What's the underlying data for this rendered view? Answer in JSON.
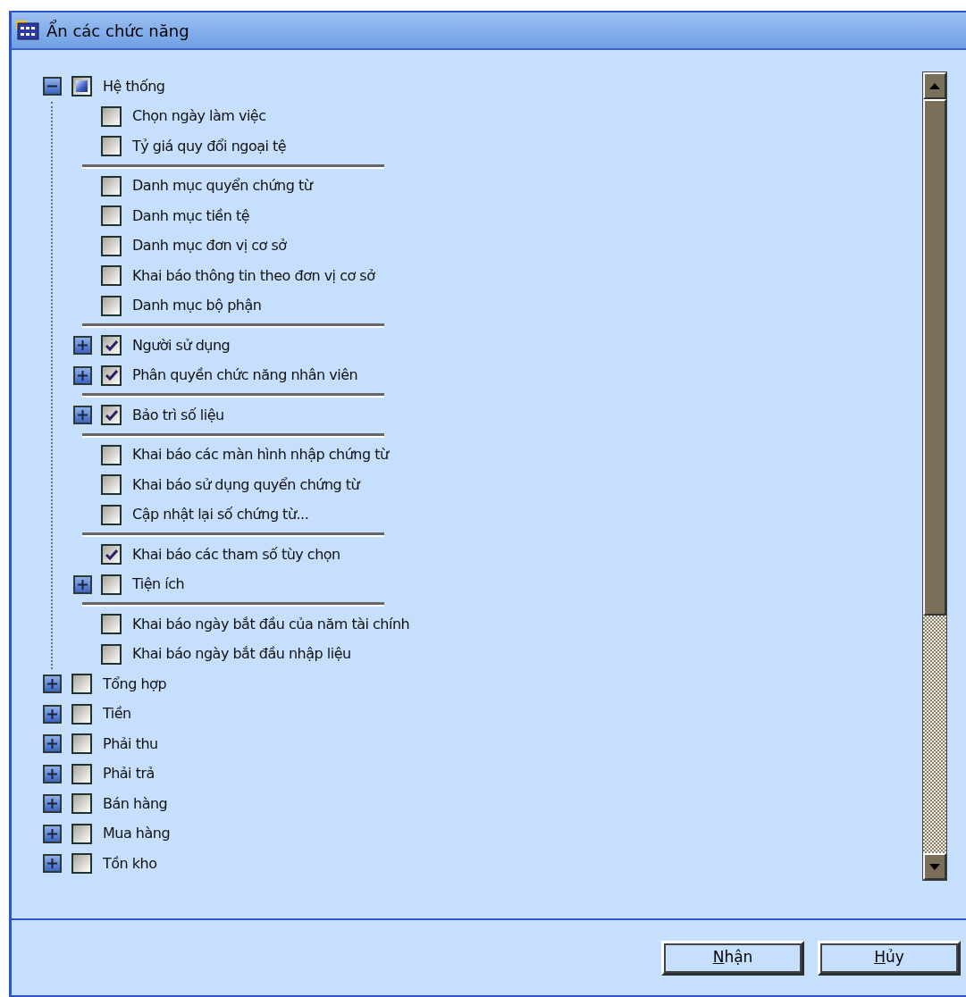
{
  "window": {
    "title": "Ẩn các chức năng"
  },
  "tree": [
    {
      "label": "Hệ thống",
      "expanded": true,
      "checked": false,
      "indeterminate": true,
      "children": [
        {
          "kind": "item",
          "label": "Chọn ngày làm việc",
          "checked": false
        },
        {
          "kind": "item",
          "label": "Tỷ giá quy đổi ngoại tệ",
          "checked": false
        },
        {
          "kind": "separator"
        },
        {
          "kind": "item",
          "label": "Danh mục quyển chứng từ",
          "checked": false
        },
        {
          "kind": "item",
          "label": "Danh mục tiền tệ",
          "checked": false
        },
        {
          "kind": "item",
          "label": "Danh mục đơn vị cơ sở",
          "checked": false
        },
        {
          "kind": "item",
          "label": "Khai báo thông tin theo đơn vị cơ sở",
          "checked": false
        },
        {
          "kind": "item",
          "label": "Danh mục bộ phận",
          "checked": false
        },
        {
          "kind": "separator"
        },
        {
          "kind": "item",
          "label": "Người sử dụng",
          "checked": true,
          "expanded": false
        },
        {
          "kind": "item",
          "label": "Phân quyền chức năng nhân viên",
          "checked": true,
          "expanded": false
        },
        {
          "kind": "separator"
        },
        {
          "kind": "item",
          "label": "Bảo trì số liệu",
          "checked": true,
          "expanded": false
        },
        {
          "kind": "separator"
        },
        {
          "kind": "item",
          "label": "Khai báo các màn hình nhập chứng từ",
          "checked": false
        },
        {
          "kind": "item",
          "label": "Khai báo sử dụng quyển chứng từ",
          "checked": false
        },
        {
          "kind": "item",
          "label": "Cập nhật lại số chứng từ...",
          "checked": false
        },
        {
          "kind": "separator"
        },
        {
          "kind": "item",
          "label": "Khai báo các tham số tùy chọn",
          "checked": true
        },
        {
          "kind": "item",
          "label": "Tiện ích",
          "checked": false,
          "expanded": false
        },
        {
          "kind": "separator"
        },
        {
          "kind": "item",
          "label": "Khai báo ngày bắt đầu của năm tài chính",
          "checked": false
        },
        {
          "kind": "item",
          "label": "Khai báo ngày bắt đầu nhập liệu",
          "checked": false
        }
      ]
    },
    {
      "label": "Tổng hợp",
      "expanded": false,
      "checked": false,
      "indeterminate": false
    },
    {
      "label": "Tiền",
      "expanded": false,
      "checked": false,
      "indeterminate": false
    },
    {
      "label": "Phải thu",
      "expanded": false,
      "checked": false,
      "indeterminate": false
    },
    {
      "label": "Phải trả",
      "expanded": false,
      "checked": false,
      "indeterminate": false
    },
    {
      "label": "Bán hàng",
      "expanded": false,
      "checked": false,
      "indeterminate": false
    },
    {
      "label": "Mua hàng",
      "expanded": false,
      "checked": false,
      "indeterminate": false
    },
    {
      "label": "Tồn kho",
      "expanded": false,
      "checked": false,
      "indeterminate": false
    }
  ],
  "buttons": [
    "Nhận",
    "Hủy"
  ]
}
